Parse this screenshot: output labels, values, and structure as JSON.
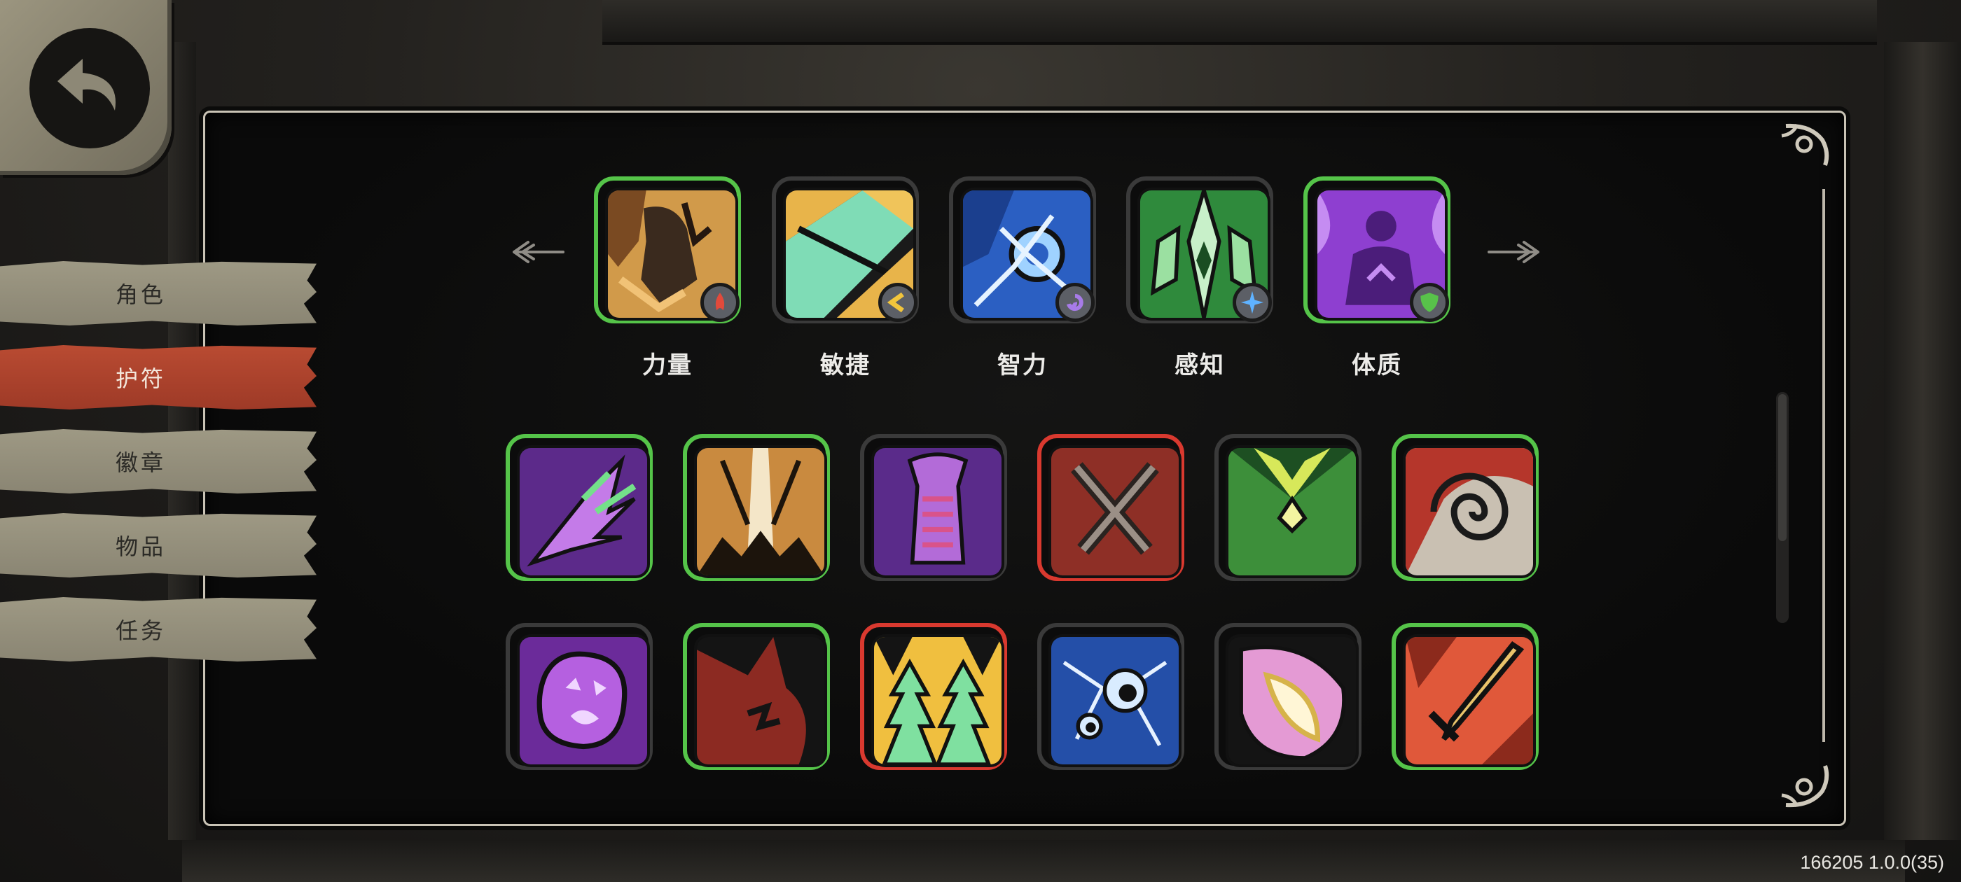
{
  "colors": {
    "accent_active_tab": "#b94b32",
    "tab_inactive": "#9e9984",
    "rarity_green": "#55c449",
    "rarity_red": "#d9392f",
    "rarity_gray": "#3a3a3a",
    "panel_border": "#c9c3b5"
  },
  "back_button": {
    "icon": "back-arrow-icon"
  },
  "sidebar": {
    "tabs": [
      {
        "label": "角色",
        "active": false
      },
      {
        "label": "护符",
        "active": true
      },
      {
        "label": "徽章",
        "active": false
      },
      {
        "label": "物品",
        "active": false
      },
      {
        "label": "任务",
        "active": false
      }
    ]
  },
  "attribute_carousel": {
    "prev_icon": "left-arrow-icon",
    "next_icon": "right-arrow-icon",
    "items": [
      {
        "label": "力量",
        "rarity": "green",
        "icon": "strength-fist-icon",
        "badge": "red-flame-badge-icon"
      },
      {
        "label": "敏捷",
        "rarity": "gray",
        "icon": "agility-shard-icon",
        "badge": "yellow-chevron-badge-icon"
      },
      {
        "label": "智力",
        "rarity": "gray",
        "icon": "intelligence-orb-icon",
        "badge": "purple-swirl-badge-icon"
      },
      {
        "label": "感知",
        "rarity": "gray",
        "icon": "perception-blade-icon",
        "badge": "blue-star-badge-icon"
      },
      {
        "label": "体质",
        "rarity": "green",
        "icon": "constitution-figure-icon",
        "badge": "green-shield-badge-icon"
      }
    ]
  },
  "amulet_grid": {
    "rows": [
      [
        {
          "rarity": "green",
          "icon": "purple-claw-amulet-icon"
        },
        {
          "rarity": "green",
          "icon": "golden-eruption-amulet-icon"
        },
        {
          "rarity": "gray",
          "icon": "purple-spine-amulet-icon"
        },
        {
          "rarity": "red",
          "icon": "crossed-swords-amulet-icon"
        },
        {
          "rarity": "gray",
          "icon": "green-mantle-amulet-icon"
        },
        {
          "rarity": "green",
          "icon": "red-spiral-amulet-icon"
        }
      ],
      [
        {
          "rarity": "gray",
          "icon": "purple-blob-amulet-icon"
        },
        {
          "rarity": "green",
          "icon": "red-beast-amulet-icon"
        },
        {
          "rarity": "red",
          "icon": "green-arrows-amulet-icon"
        },
        {
          "rarity": "gray",
          "icon": "blue-eyes-amulet-icon"
        },
        {
          "rarity": "gray",
          "icon": "pink-eye-amulet-icon"
        },
        {
          "rarity": "green",
          "icon": "flaming-sword-amulet-icon"
        }
      ]
    ]
  },
  "scrollbar": {
    "position": 0
  },
  "footer": {
    "version": "166205 1.0.0(35)"
  }
}
